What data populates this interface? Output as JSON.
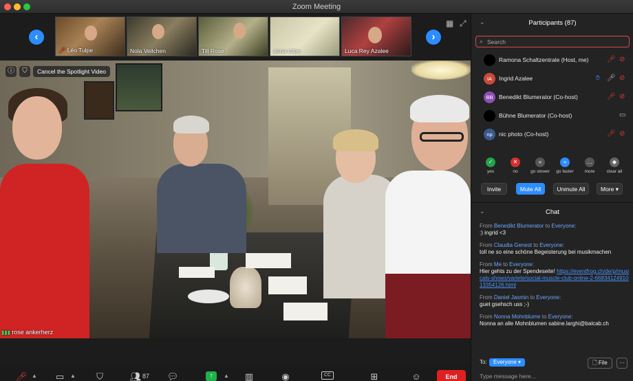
{
  "window": {
    "title": "Zoom Meeting"
  },
  "thumbnails": [
    {
      "name": "Léo Tulpe",
      "mic_muted": true
    },
    {
      "name": "Nola Veilchen",
      "mic_muted": false
    },
    {
      "name": "Till Rose",
      "mic_muted": false
    },
    {
      "name": "anna tulpe",
      "mic_muted": false
    },
    {
      "name": "Luca Rey Azalee",
      "mic_muted": false
    }
  ],
  "strip_nav": {
    "prev": "‹",
    "next": "›"
  },
  "spotlight": {
    "cancel_label": "Cancel the Spotlight Video",
    "speaker_name": "rose ankerherz"
  },
  "toolbar": {
    "participants_count": "87",
    "cc_label": "CC",
    "end_label": "End"
  },
  "participants_panel": {
    "title": "Participants (87)",
    "search_placeholder": "Search",
    "participants": [
      {
        "name": "Ramona Schaltzentrale (Host, me)",
        "initials": "",
        "avatar_color": "#000000",
        "mic": "off",
        "video": "off",
        "hand": false
      },
      {
        "name": "Ingrid Azalee",
        "initials": "IA",
        "avatar_color": "#c94a3a",
        "mic": "on",
        "video": "off",
        "hand": true
      },
      {
        "name": "Benedikt Blumerator (Co-host)",
        "initials": "BB",
        "avatar_color": "#8e4fb5",
        "mic": "off",
        "video": "off",
        "hand": false
      },
      {
        "name": "Bühne Blumerator (Co-host)",
        "initials": "",
        "avatar_color": "#000000",
        "mic": "none",
        "video": "on",
        "hand": false
      },
      {
        "name": "nic photo (Co-host)",
        "initials": "np",
        "avatar_color": "#3a5a8c",
        "mic": "off",
        "video": "off",
        "hand": false
      }
    ],
    "reactions": [
      {
        "label": "yes",
        "symbol": "✓",
        "color": "#22a34a"
      },
      {
        "label": "no",
        "symbol": "✕",
        "color": "#d43030"
      },
      {
        "label": "go slower",
        "symbol": "«",
        "color": "#555555"
      },
      {
        "label": "go faster",
        "symbol": "»",
        "color": "#2d8cff"
      },
      {
        "label": "more",
        "symbol": "…",
        "color": "#555555"
      },
      {
        "label": "clear all",
        "symbol": "◆",
        "color": "#666666"
      }
    ],
    "buttons": {
      "invite": "Invite",
      "mute_all": "Mute All",
      "unmute_all": "Unmute All",
      "more": "More ▾"
    }
  },
  "chat": {
    "title": "Chat",
    "messages": [
      {
        "from": "Benedikt Blumerator",
        "to": "Everyone",
        "text": ":) ingrid <3",
        "link": ""
      },
      {
        "from": "Claudia Genest",
        "to": "Everyone",
        "text": "toll ne so eine schöne Begeisterung bei musikmachen",
        "link": ""
      },
      {
        "from": "Me",
        "to": "Everyone",
        "text": "Hier gehts zu der Spendeseite! ",
        "link": "https://eventfrog.ch/de/p/musicals-shows/variete/social-muscle-club-online-2-6683412491013354126.html"
      },
      {
        "from": "Daniel Jasmin",
        "to": "Everyone",
        "text": "guet gsehsch uss ;-)",
        "link": ""
      },
      {
        "from": "Nonna Mohnblume",
        "to": "Everyone",
        "text": "Nonna an alle Mohnblumen sabine.larghi@balcab.ch",
        "link": ""
      }
    ],
    "from_prefix": "From",
    "to_word": "to",
    "to_label": "To:",
    "to_value": "Everyone ▾",
    "file_label": "File",
    "more_label": "···",
    "input_placeholder": "Type message here..."
  },
  "colors": {
    "accent": "#2d8cff",
    "danger": "#e02020",
    "share": "#20b14b",
    "panel_bg": "#232323"
  }
}
